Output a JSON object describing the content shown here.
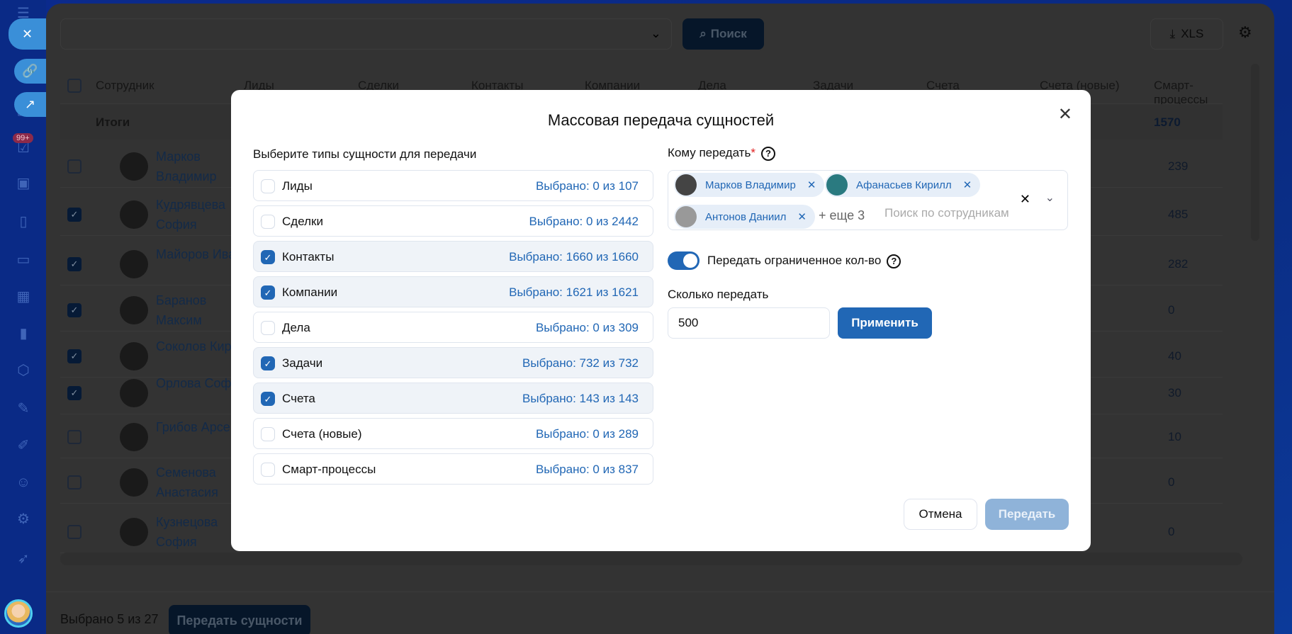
{
  "sidebar": {
    "badge": "99+",
    "float_buttons": [
      "close-icon",
      "link-icon",
      "external-link-icon"
    ]
  },
  "toolbar": {
    "search_label": "Поиск",
    "xls_label": "XLS"
  },
  "table": {
    "columns": [
      "Сотрудник",
      "Лиды",
      "Сделки",
      "Контакты",
      "Компании",
      "Дела",
      "Задачи",
      "Счета",
      "Счета (новые)",
      "Смарт-процессы"
    ],
    "totals_label": "Итоги",
    "totals_smart": "1570",
    "rows": [
      {
        "name": "Марков Владимир",
        "checked": false,
        "smart": "239"
      },
      {
        "name": "Кудрявцева София",
        "checked": true,
        "smart": "485"
      },
      {
        "name": "Майоров Иван",
        "checked": true,
        "smart": "282"
      },
      {
        "name": "Баранов Максим",
        "checked": true,
        "smart": "0"
      },
      {
        "name": "Соколов Кирилл",
        "checked": true,
        "smart": "40"
      },
      {
        "name": "Орлова София",
        "checked": true,
        "smart": "30"
      },
      {
        "name": "Грибов Арсений",
        "checked": false,
        "smart": "10"
      },
      {
        "name": "Семенова Анастасия",
        "checked": false,
        "smart": "0"
      },
      {
        "name": "Кузнецова София",
        "checked": false,
        "smart": "0"
      }
    ]
  },
  "footer": {
    "selected": "Выбрано 5 из 27",
    "transfer_label": "Передать сущности"
  },
  "modal": {
    "title": "Массовая передача сущностей",
    "types_label": "Выберите типы сущности для передачи",
    "entities": [
      {
        "name": "Лиды",
        "count": "Выбрано: 0 из 107",
        "checked": false
      },
      {
        "name": "Сделки",
        "count": "Выбрано: 0 из 2442",
        "checked": false
      },
      {
        "name": "Контакты",
        "count": "Выбрано: 1660 из 1660",
        "checked": true
      },
      {
        "name": "Компании",
        "count": "Выбрано: 1621 из 1621",
        "checked": true
      },
      {
        "name": "Дела",
        "count": "Выбрано: 0 из 309",
        "checked": false
      },
      {
        "name": "Задачи",
        "count": "Выбрано: 732 из 732",
        "checked": true
      },
      {
        "name": "Счета",
        "count": "Выбрано: 143 из 143",
        "checked": true
      },
      {
        "name": "Счета (новые)",
        "count": "Выбрано: 0 из 289",
        "checked": false
      },
      {
        "name": "Смарт-процессы",
        "count": "Выбрано: 0 из 837",
        "checked": false
      }
    ],
    "recipient_label": "Кому передать",
    "required_mark": "*",
    "recipients": [
      "Марков Владимир",
      "Афанасьев Кирилл",
      "Антонов Даниил"
    ],
    "more": "+ еще 3",
    "search_placeholder": "Поиск по сотрудникам",
    "limit_toggle_label": "Передать ограниченное кол-во",
    "limit_enabled": true,
    "qty_label": "Сколько передать",
    "qty_value": "500",
    "apply_label": "Применить",
    "cancel_label": "Отмена",
    "submit_label": "Передать",
    "help_glyph": "?"
  }
}
